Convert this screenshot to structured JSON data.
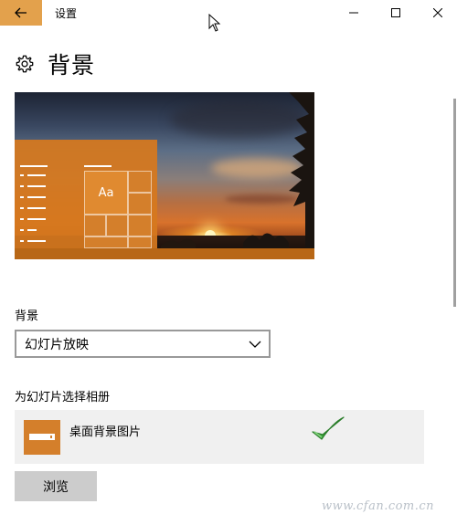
{
  "window": {
    "title": "设置",
    "accent": "#e3a14c"
  },
  "page": {
    "title": "背景"
  },
  "background": {
    "label": "背景",
    "selected": "幻灯片放映"
  },
  "album": {
    "label": "为幻灯片选择相册",
    "item": "桌面背景图片"
  },
  "browse": {
    "label": "浏览"
  },
  "preview": {
    "tile_text": "Aa",
    "accent": "#d47f2b"
  },
  "watermark": "www.cfan.com.cn",
  "icons": [
    "back-arrow-icon",
    "minimize-icon",
    "maximize-icon",
    "close-icon",
    "gear-icon",
    "chevron-down-icon",
    "checkmark-icon",
    "mouse-cursor-icon"
  ]
}
